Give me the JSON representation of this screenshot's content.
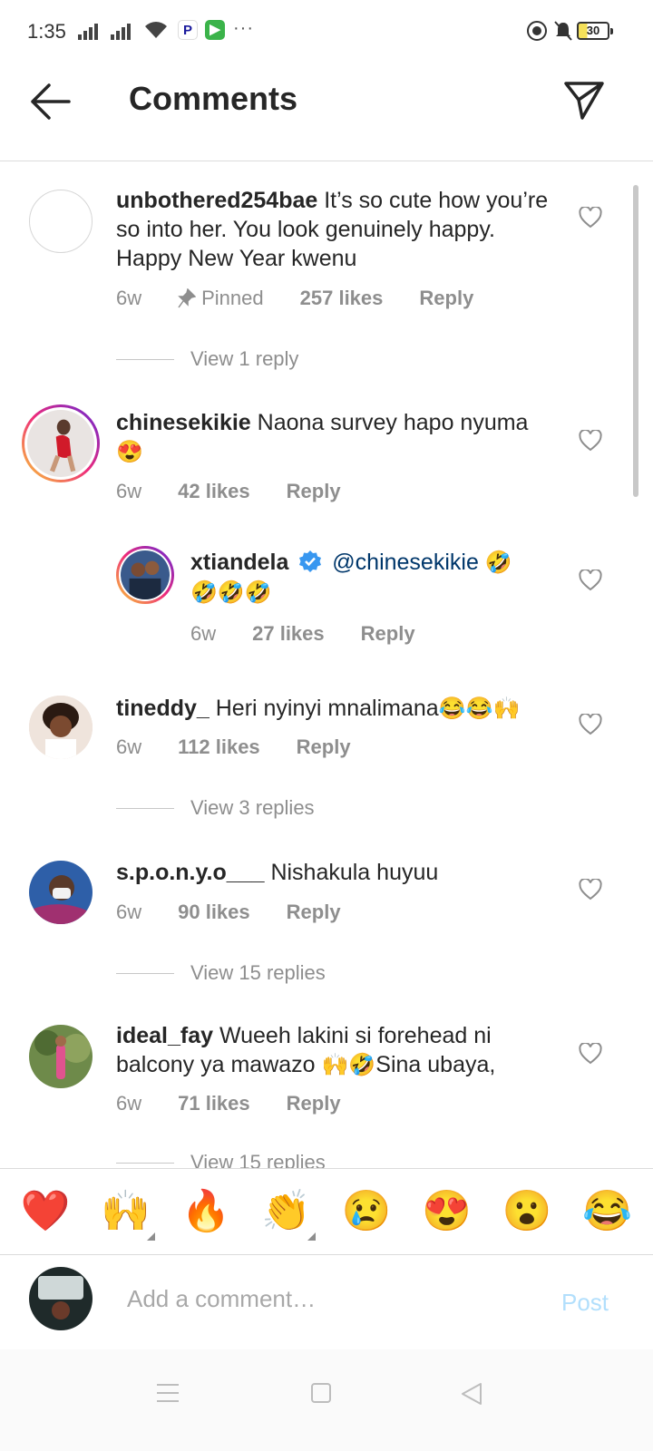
{
  "status_bar": {
    "time": "1:35",
    "battery": "30",
    "more": "···"
  },
  "header": {
    "title": "Comments"
  },
  "comments": [
    {
      "username": "unbothered254bae",
      "text": "It’s so cute how you’re so into her. You look genuinely happy. Happy New Year kwenu",
      "age": "6w",
      "pinned_label": "Pinned",
      "likes": "257 likes",
      "reply_label": "Reply",
      "view_replies": "View 1 reply"
    },
    {
      "username": "chinesekikie",
      "text": "Naona survey hapo nyuma",
      "emoji": "😍",
      "age": "6w",
      "likes": "42 likes",
      "reply_label": "Reply"
    },
    {
      "username": "xtiandela",
      "mention": "@chinesekikie",
      "emoji_inline": "🤣",
      "emoji_line2": "🤣🤣🤣",
      "age": "6w",
      "likes": "27 likes",
      "reply_label": "Reply",
      "is_reply": true,
      "verified": true
    },
    {
      "username": "tineddy_",
      "text": "Heri nyinyi mnalimana",
      "emoji": "😂😂🙌",
      "age": "6w",
      "likes": "112 likes",
      "reply_label": "Reply",
      "view_replies": "View 3 replies"
    },
    {
      "username": "s.p.o.n.y.o___",
      "text": "Nishakula huyuu",
      "age": "6w",
      "likes": "90 likes",
      "reply_label": "Reply",
      "view_replies": "View 15 replies"
    },
    {
      "username": "ideal_fay",
      "text_line1": "Wueeh  lakini si forehead ni",
      "text_line2_a": "balcony ya mawazo ",
      "text_line2_emoji": "🙌🤣",
      "text_line2_b": "Sina ubaya,",
      "age": "6w",
      "likes": "71 likes",
      "reply_label": "Reply",
      "view_replies": "View 15 replies"
    }
  ],
  "emoji_bar": [
    "❤️",
    "🙌",
    "🔥",
    "👏",
    "😢",
    "😍",
    "😮",
    "😂"
  ],
  "composer": {
    "placeholder": "Add a comment…",
    "post_label": "Post"
  },
  "colors": {
    "link_blue": "#00376b",
    "post_disabled": "#b2dffc",
    "secondary_text": "#8e8e8e",
    "verified_blue": "#3897f0"
  }
}
